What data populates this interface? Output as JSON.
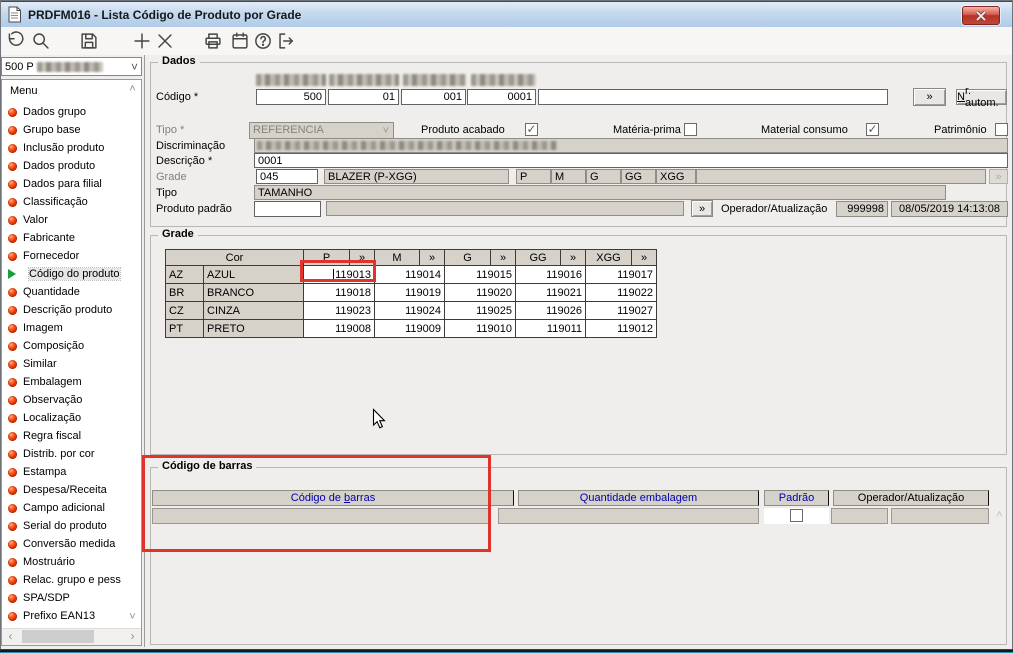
{
  "window": {
    "title": "PRDFM016 - Lista Código de Produto por Grade"
  },
  "icons": {
    "dropdown": "˅",
    "scroll_up": "˄",
    "scroll_down": "˅",
    "scroll_left": "‹",
    "scroll_right": "›"
  },
  "toolbar": {
    "buttons": [
      "undo",
      "search",
      "save",
      "add",
      "delete",
      "print",
      "calendar",
      "help",
      "exit"
    ]
  },
  "sidebar": {
    "dropdown_value": "500 P",
    "menu_title": "Menu",
    "items": [
      {
        "label": "Dados grupo"
      },
      {
        "label": "Grupo base"
      },
      {
        "label": "Inclusão produto"
      },
      {
        "label": "Dados produto"
      },
      {
        "label": "Dados para filial"
      },
      {
        "label": "Classificação"
      },
      {
        "label": "Valor"
      },
      {
        "label": "Fabricante"
      },
      {
        "label": "Fornecedor"
      },
      {
        "label": "Código do produto",
        "selected": true
      },
      {
        "label": "Quantidade"
      },
      {
        "label": "Descrição produto"
      },
      {
        "label": "Imagem"
      },
      {
        "label": "Composição"
      },
      {
        "label": "Similar"
      },
      {
        "label": "Embalagem"
      },
      {
        "label": "Observação"
      },
      {
        "label": "Localização"
      },
      {
        "label": "Regra fiscal"
      },
      {
        "label": "Distrib. por cor"
      },
      {
        "label": "Estampa"
      },
      {
        "label": "Despesa/Receita"
      },
      {
        "label": "Campo adicional"
      },
      {
        "label": "Serial do produto"
      },
      {
        "label": "Conversão medida"
      },
      {
        "label": "Mostruário"
      },
      {
        "label": "Relac. grupo e pess"
      },
      {
        "label": "SPA/SDP"
      },
      {
        "label": "Prefixo EAN13"
      }
    ],
    "partial_bottom_item": true
  },
  "dados": {
    "title": "Dados",
    "codigo": {
      "label": "Código *",
      "values": [
        "500",
        "01",
        "001",
        "0001"
      ],
      "extra_value": ""
    },
    "more": "»",
    "nr_autom": {
      "accel": "N",
      "rest": "r. autom."
    },
    "tipo": {
      "label": "Tipo *",
      "value": "REFERENCIA"
    },
    "flags": [
      {
        "label": "Produto acabado",
        "checked": true,
        "mark": "✓"
      },
      {
        "label": "Matéria-prima",
        "checked": false,
        "mark": ""
      },
      {
        "label": "Material consumo",
        "checked": true,
        "mark": "✓"
      },
      {
        "label": "Patrimônio",
        "checked": false,
        "mark": ""
      }
    ],
    "discriminacao": {
      "label": "Discriminação"
    },
    "descricao": {
      "label": "Descrição *",
      "value": "0001"
    },
    "grade": {
      "label": "Grade",
      "code": "045",
      "name": "BLAZER (P-XGG)",
      "sizes": [
        "P",
        "M",
        "G",
        "GG",
        "XGG"
      ]
    },
    "tipo_grade": {
      "label": "Tipo",
      "value": "TAMANHO"
    },
    "produto_padrao": {
      "label": "Produto padrão",
      "code": "",
      "name": ""
    },
    "operador": {
      "label": "Operador/Atualização",
      "user": "999998",
      "timestamp": "08/05/2019 14:13:08"
    }
  },
  "grade_table": {
    "title": "Grade",
    "cor_header": "Cor",
    "expand": "»",
    "sizes": [
      "P",
      "M",
      "G",
      "GG",
      "XGG"
    ],
    "rows": [
      {
        "code": "AZ",
        "color": "AZUL",
        "values": [
          "119013",
          "119014",
          "119015",
          "119016",
          "119017"
        ]
      },
      {
        "code": "BR",
        "color": "BRANCO",
        "values": [
          "119018",
          "119019",
          "119020",
          "119021",
          "119022"
        ]
      },
      {
        "code": "CZ",
        "color": "CINZA",
        "values": [
          "119023",
          "119024",
          "119025",
          "119026",
          "119027"
        ]
      },
      {
        "code": "PT",
        "color": "PRETO",
        "values": [
          "119008",
          "119009",
          "119010",
          "119011",
          "119012"
        ]
      }
    ],
    "highlighted_cell": "119013"
  },
  "barcode": {
    "title": "Código de barras",
    "h1_prefix": "Código de ",
    "h1_accel": "b",
    "h1_rest": "arras",
    "h2": "Quantidade embalagem",
    "h3": "Padrão",
    "h4": "Operador/Atualização",
    "padrao_checked": false
  },
  "colors": {
    "annotation_red": "#e0342b",
    "header_blue": "#0000b0",
    "titlebar_blue": "#b0cbe8"
  }
}
